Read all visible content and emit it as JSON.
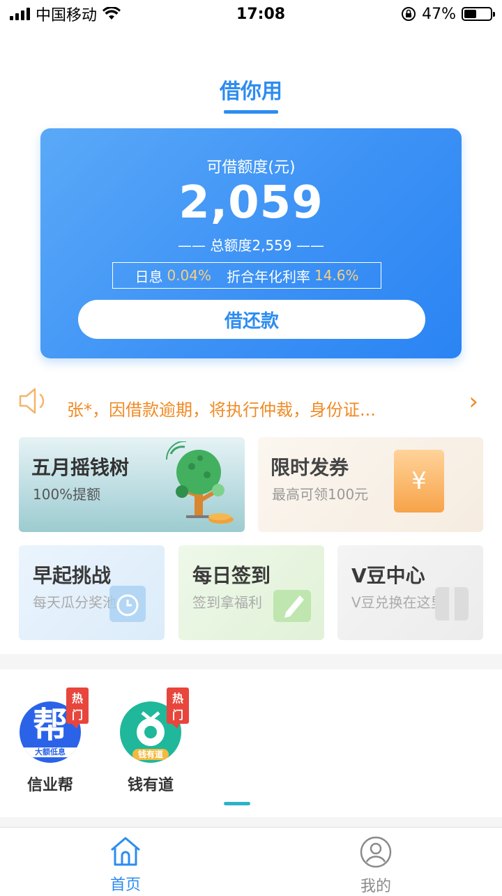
{
  "status_bar": {
    "carrier": "中国移动",
    "time": "17:08",
    "battery": "47%",
    "battery_level": 0.47
  },
  "page": {
    "title": "借你用"
  },
  "loan_card": {
    "label": "可借额度(元)",
    "amount": "2,059",
    "total": "—— 总额度2,559 ——",
    "daily_label": "日息",
    "daily_rate": "0.04%",
    "annual_label": "折合年化利率",
    "annual_rate": "14.6%",
    "button": "借还款"
  },
  "notice": {
    "text": "张*，因借款逾期，将执行仲裁，身份证..."
  },
  "promos": [
    {
      "title": "五月摇钱树",
      "subtitle": "100%提额"
    },
    {
      "title": "限时发券",
      "subtitle": "最高可领100元",
      "coupon_symbol": "¥"
    }
  ],
  "mini_cards": [
    {
      "title": "早起挑战",
      "subtitle": "每天瓜分奖池"
    },
    {
      "title": "每日签到",
      "subtitle": "签到拿福利"
    },
    {
      "title": "V豆中心",
      "subtitle": "V豆兑换在这里"
    }
  ],
  "apps": [
    {
      "name": "信业帮",
      "badge": "热门",
      "logo_text": "帮",
      "logo_subtext": "大额低息",
      "color": "#2b63e8"
    },
    {
      "name": "钱有道",
      "badge": "热门",
      "logo_subtext": "钱有道",
      "color": "#1fb89a"
    }
  ],
  "tabs": [
    {
      "label": "首页",
      "icon": "home-icon",
      "active": true
    },
    {
      "label": "我的",
      "icon": "user-icon",
      "active": false
    }
  ],
  "colors": {
    "primary": "#2d8cf0",
    "notice": "#f08a24",
    "hot": "#e8453c",
    "rate_highlight": "#f7cf83"
  }
}
